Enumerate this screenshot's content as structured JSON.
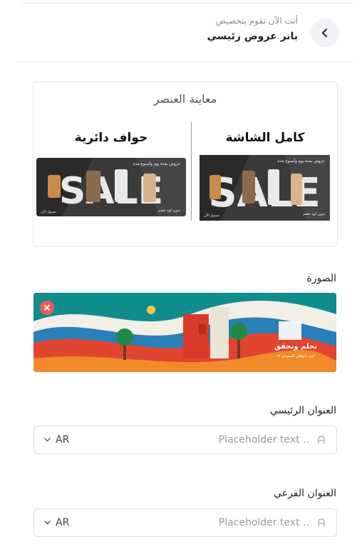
{
  "header": {
    "subtitle": "أنت الآن تقوم بتخصيص",
    "title": "بانر عروض رئيسي",
    "back_icon": "chevron-left-icon"
  },
  "preview": {
    "title": "معاينة العنصر",
    "variants": [
      {
        "label": "كامل الشاشة",
        "banner_text": "SALE",
        "banner_top": "عروض بمدة يوم وأسبوع مدة",
        "banner_bottom_left": "تسوق الآن",
        "banner_bottom_right": "بدون كود خصم"
      },
      {
        "label": "حواف دائرية",
        "banner_text": "SALE",
        "banner_top": "عروض بمدة يوم وأسبوع مدة",
        "banner_bottom_left": "تسوق الآن",
        "banner_bottom_right": "بدون كود خصم"
      }
    ]
  },
  "image_section": {
    "label": "الصورة",
    "remove_icon": "close-icon",
    "caption_main": "نحلم ونحقق",
    "caption_sub": "اليوم الوطني السعودي ٩٢"
  },
  "main_title": {
    "label": "العنوان الرئيسي",
    "placeholder": "Placeholder text ..",
    "lang": "AR"
  },
  "sub_title": {
    "label": "العنوان الفرعي",
    "placeholder": "Placeholder text ..",
    "lang": "AR"
  },
  "colors": {
    "accent_red": "#ef5a5a",
    "border": "#dedede",
    "teal": "#0f8a8a"
  }
}
